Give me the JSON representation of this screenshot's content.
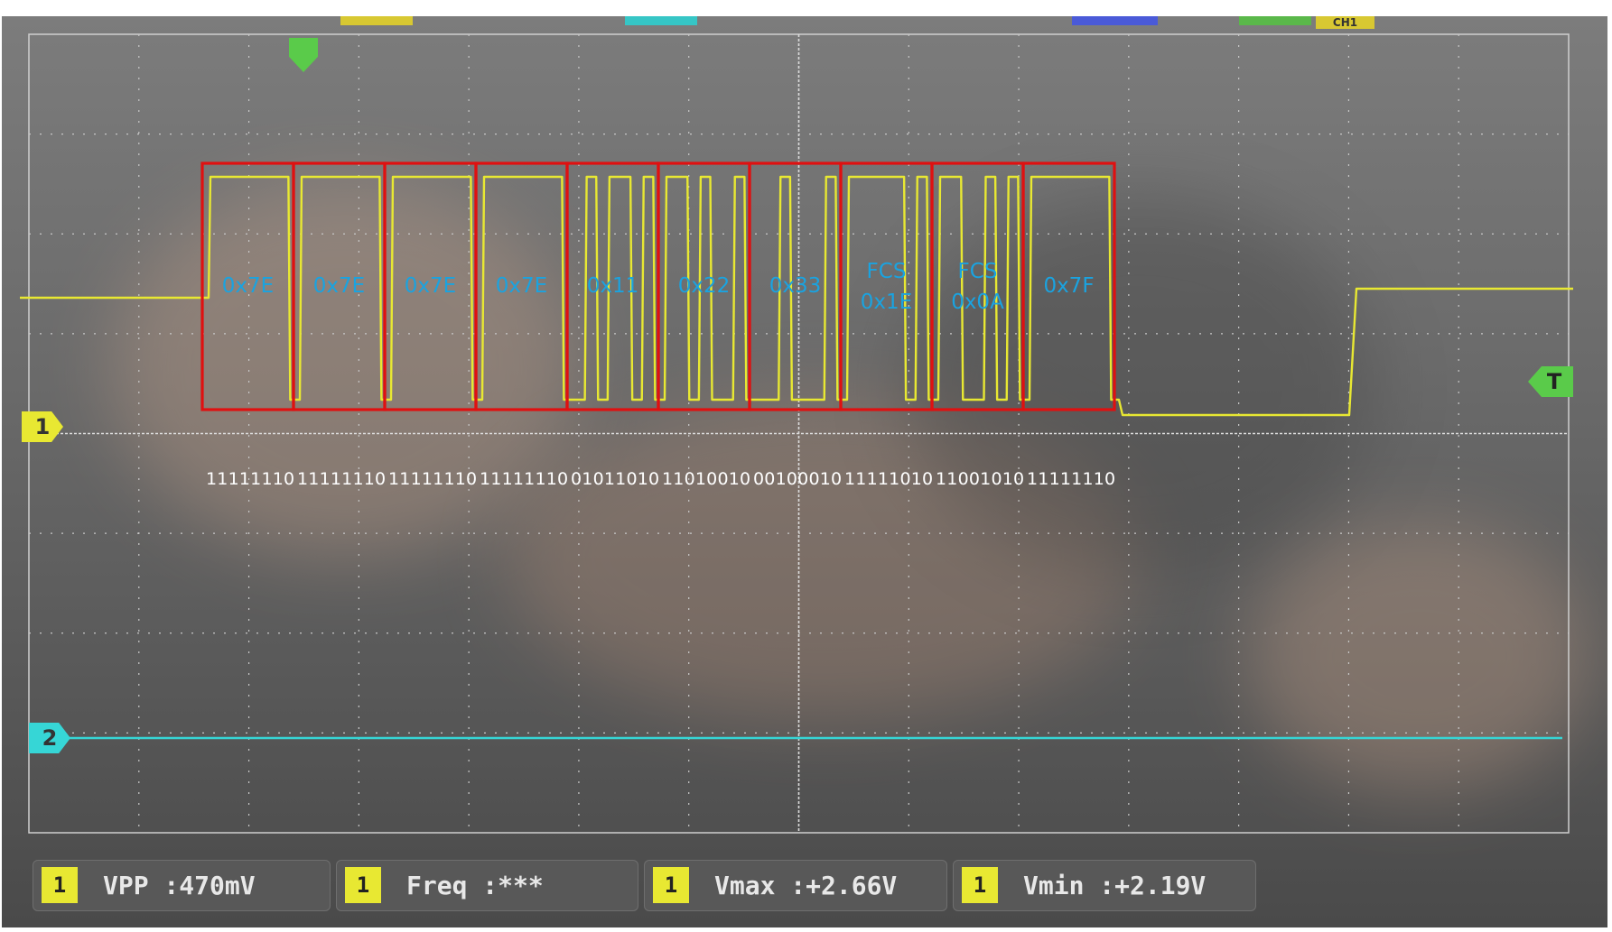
{
  "trace_colors": {
    "ch1": "#e8e832",
    "ch2": "#36d6d6",
    "box": "#e01010",
    "label": "#1aa3e0",
    "bits": "#ffffff"
  },
  "markers": {
    "ch1": "1",
    "ch2": "2",
    "trigger": "T"
  },
  "frames": [
    {
      "label": [
        "0x7E"
      ],
      "bits": "11111110"
    },
    {
      "label": [
        "0x7E"
      ],
      "bits": "11111110"
    },
    {
      "label": [
        "0x7E"
      ],
      "bits": "11111110"
    },
    {
      "label": [
        "0x7E"
      ],
      "bits": "11111110"
    },
    {
      "label": [
        "0x11"
      ],
      "bits": "01011010"
    },
    {
      "label": [
        "0x22"
      ],
      "bits": "11010010"
    },
    {
      "label": [
        "0x33"
      ],
      "bits": "00100010"
    },
    {
      "label": [
        "FCS",
        "0x1E"
      ],
      "bits": "11111010"
    },
    {
      "label": [
        "FCS",
        "0x0A"
      ],
      "bits": "11001010"
    },
    {
      "label": [
        "0x7F"
      ],
      "bits": "11111110"
    }
  ],
  "measurements": [
    {
      "channel": "1",
      "text": "VPP  :470mV"
    },
    {
      "channel": "1",
      "text": "Freq :***"
    },
    {
      "channel": "1",
      "text": "Vmax :+2.66V"
    },
    {
      "channel": "1",
      "text": "Vmin :+2.19V"
    }
  ],
  "top_indicator": "CH1"
}
